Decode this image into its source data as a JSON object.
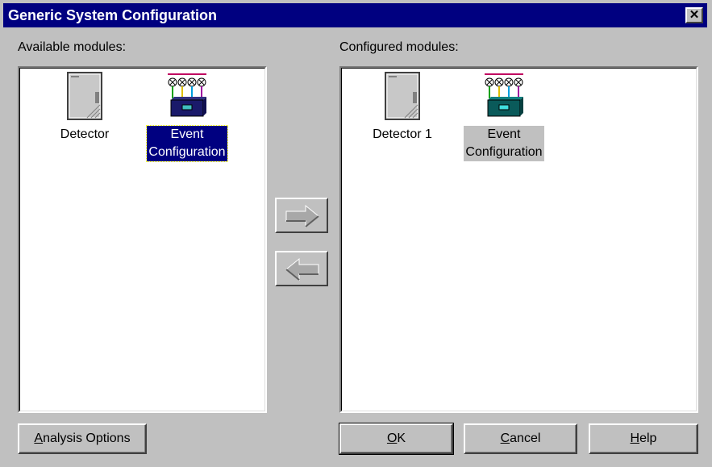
{
  "window": {
    "title": "Generic System Configuration",
    "close_glyph": "✕"
  },
  "available": {
    "label": "Available modules:",
    "items": [
      {
        "label": "Detector",
        "icon": "detector-icon"
      },
      {
        "label_line1": "Event",
        "label_line2": "Configuration",
        "icon": "event-configuration-icon",
        "selected": true
      }
    ]
  },
  "configured": {
    "label": "Configured modules:",
    "items": [
      {
        "label": "Detector 1",
        "icon": "detector-icon"
      },
      {
        "label_line1": "Event",
        "label_line2": "Configuration",
        "icon": "event-configuration-icon",
        "selected": true
      }
    ]
  },
  "transfer": {
    "add_icon": "arrow-right-icon",
    "remove_icon": "arrow-left-icon"
  },
  "buttons": {
    "analysis_options": {
      "mnemonic": "A",
      "rest": "nalysis Options"
    },
    "ok": {
      "mnemonic": "O",
      "rest": "K"
    },
    "cancel": {
      "mnemonic": "C",
      "rest": "ancel"
    },
    "help": {
      "mnemonic": "H",
      "rest": "elp"
    }
  },
  "colors": {
    "title_bar": "#000080",
    "dialog_face": "#c0c0c0",
    "selection": "#000080"
  }
}
